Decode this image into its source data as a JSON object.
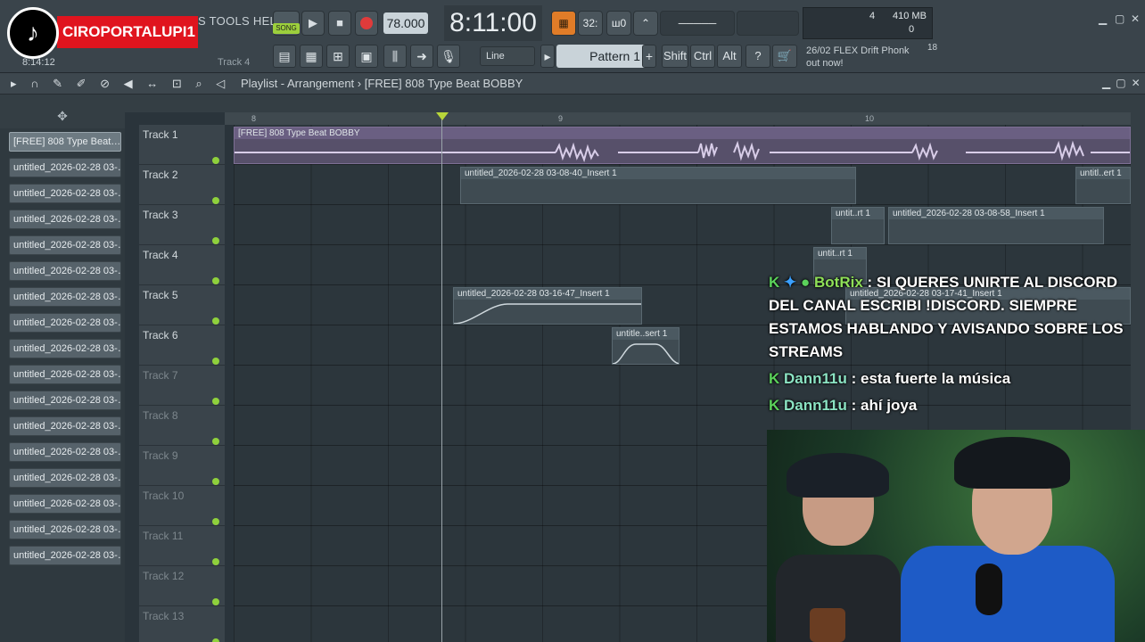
{
  "topbar": {
    "menu_text": "S TOOLS HELP",
    "channel_logo_text": "CIROPORTALUPI1",
    "small_clock": "8:14:12",
    "track_hint": "Track 4",
    "song_label": "SONG",
    "tempo": "78.000",
    "big_clock": "8:11:00",
    "cpu_value": "4",
    "mem_value": "410 MB",
    "voices_value": "0",
    "line_select": "Line",
    "pattern_select": "Pattern 1",
    "shift_label": "Shift",
    "ctrl_label": "Ctrl",
    "alt_label": "Alt",
    "news_text": "26/02  FLEX  Drift Phonk",
    "news_sub": "out now!",
    "news_count": "18",
    "btn_32": "32:",
    "btn_wo": "ш0"
  },
  "playlist": {
    "title": "Playlist - Arrangement",
    "breadcrumb_sep": "›",
    "project": "[FREE] 808 Type Beat BOBBY"
  },
  "picker_items": [
    "[FREE] 808 Type Beat…",
    "untitled_2026-02-28 03-…",
    "untitled_2026-02-28 03-…",
    "untitled_2026-02-28 03-…",
    "untitled_2026-02-28 03-…",
    "untitled_2026-02-28 03-…",
    "untitled_2026-02-28 03-…",
    "untitled_2026-02-28 03-…",
    "untitled_2026-02-28 03-…",
    "untitled_2026-02-28 03-…",
    "untitled_2026-02-28 03-…",
    "untitled_2026-02-28 03-…",
    "untitled_2026-02-28 03-…",
    "untitled_2026-02-28 03-…",
    "untitled_2026-02-28 03-…",
    "untitled_2026-02-28 03-…",
    "untitled_2026-02-28 03-…"
  ],
  "tracks": [
    "Track 1",
    "Track 2",
    "Track 3",
    "Track 4",
    "Track 5",
    "Track 6",
    "Track 7",
    "Track 8",
    "Track 9",
    "Track 10",
    "Track 11",
    "Track 12",
    "Track 13"
  ],
  "ruler": {
    "bar8": "8",
    "bar9": "9",
    "bar10": "10"
  },
  "clips": {
    "audio": "[FREE] 808 Type Beat BOBBY",
    "c2": "untitled_2026-02-28 03-08-40_Insert 1",
    "c2b": "untitl..ert 1",
    "c3a": "untit..rt 1",
    "c3b": "untitled_2026-02-28 03-08-58_Insert 1",
    "c4": "untit..rt 1",
    "c5": "untitled_2026-02-28 03-16-47_Insert 1",
    "c5b": "untitled_2026-02-28 03-17-41_Insert 1",
    "c6": "untitle..sert 1"
  },
  "chat": {
    "u1": "BotRix",
    "m1": ": SI QUERES UNIRTE AL DISCORD DEL CANAL ESCRIBI !DISCORD. SIEMPRE ESTAMOS HABLANDO Y AVISANDO SOBRE LOS STREAMS",
    "u2": "Dann11u",
    "m2": ": esta fuerte la música",
    "u3": "Dann11u",
    "m3": ": ahí joya"
  }
}
